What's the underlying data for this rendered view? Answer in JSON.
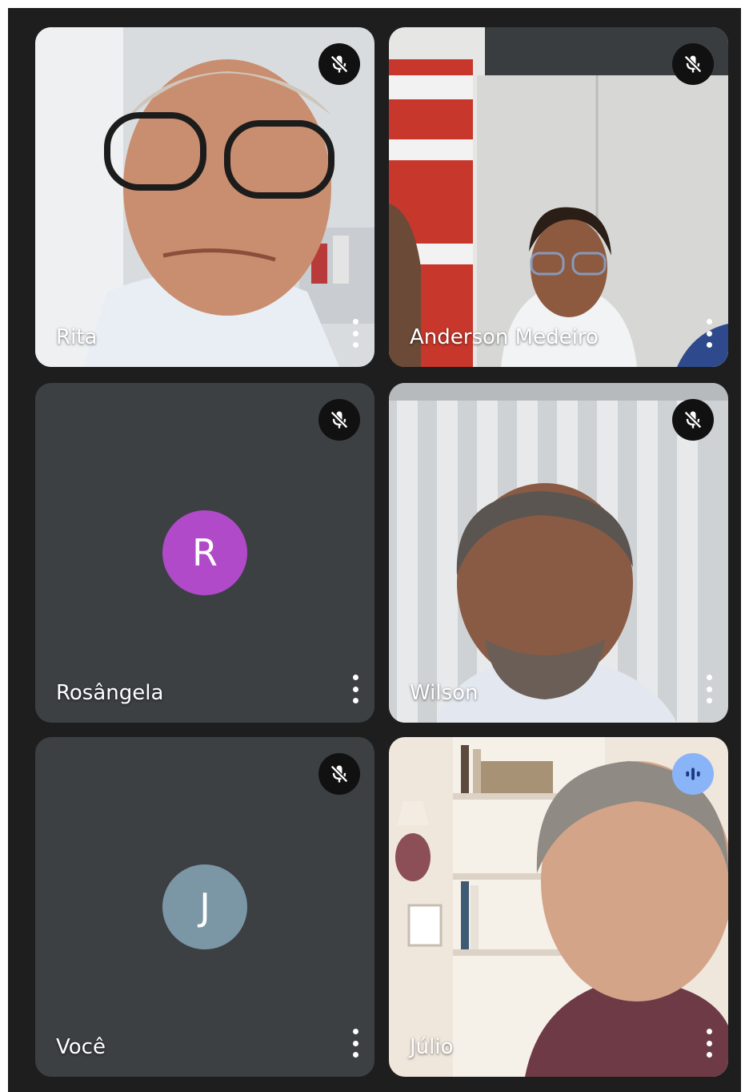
{
  "colors": {
    "background": "#1e1e1e",
    "tile": "#3c4043",
    "muted_badge": "#111111",
    "speaking_badge": "#8ab4f8"
  },
  "participants": [
    {
      "name": "Rita",
      "muted": true,
      "icon": "mic-off-icon"
    },
    {
      "name": "Anderson Medeiro",
      "muted": true,
      "icon": "mic-off-icon"
    },
    {
      "name": "Rosângela",
      "muted": true,
      "icon": "mic-off-icon",
      "avatar_initial": "R",
      "avatar_color": "#b04ac9"
    },
    {
      "name": "Wilson",
      "muted": true,
      "icon": "mic-off-icon"
    },
    {
      "name": "Você",
      "muted": true,
      "icon": "mic-off-icon",
      "avatar_initial": "J",
      "avatar_color": "#7b97a6"
    },
    {
      "name": "Júlio",
      "muted": false,
      "icon": "speaking-indicator-icon"
    }
  ],
  "icons": {
    "more_options": "more-vert-icon"
  }
}
